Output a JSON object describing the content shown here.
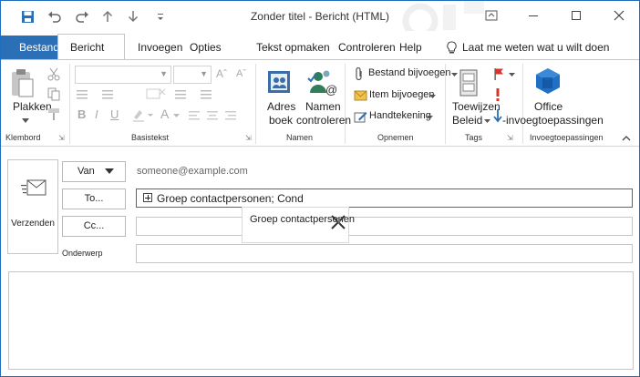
{
  "window": {
    "title": "Zonder titel - Bericht (HTML)",
    "accent": "#2b6fb6"
  },
  "quick_access": {
    "save_icon": "save-icon",
    "undo_icon": "undo-icon",
    "redo_icon": "redo-icon",
    "up_icon": "arrow-up-icon",
    "down_icon": "arrow-down-icon",
    "customize_icon": "customize-icon"
  },
  "tabs": {
    "file": "Bestand",
    "message": "Bericht",
    "insert": "Invoegen",
    "options": "Opties",
    "format": "Tekst opmaken",
    "review": "Controleren",
    "help": "Help",
    "tell_me": "Laat me weten wat u wilt doen"
  },
  "ribbon": {
    "clipboard": {
      "paste": "Plakken",
      "group": "Klembord"
    },
    "basic_text": {
      "group": "Basistekst"
    },
    "names": {
      "address_book_1": "Adres",
      "address_book_2": "boek",
      "check_names_1": "Namen",
      "check_names_2": "controleren",
      "group": "Namen"
    },
    "include": {
      "attach_file": "Bestand bijvoegen",
      "attach_item": "Item bijvoegen",
      "signature": "Handtekening",
      "group": "Opnemen"
    },
    "tags": {
      "assign_policy_1": "Toewijzen",
      "assign_policy_2": "Beleid",
      "group": "Tags"
    },
    "addins": {
      "office_1": "Office",
      "office_2": "-invoegtoepassingen",
      "group": "Invoegtoepassingen"
    }
  },
  "header": {
    "send_label": "Verzenden",
    "from_button": "Van",
    "from_address": "someone@example.com",
    "to_button": "To...",
    "to_value": "Groep contactpersonen; Cond",
    "cc_button": "Cc...",
    "subject_label": "Onderwerp",
    "drag_text": "Groep contactpersonen"
  }
}
